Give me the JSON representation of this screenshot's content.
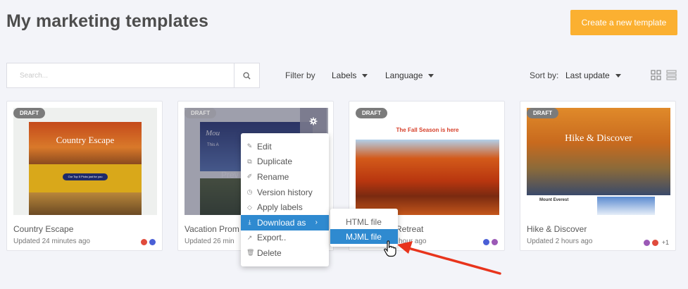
{
  "header": {
    "title": "My marketing templates",
    "create_button": "Create a new template"
  },
  "search": {
    "placeholder": "Search..."
  },
  "filters": {
    "filter_by": "Filter by",
    "labels": "Labels",
    "language": "Language",
    "sort_by": "Sort by:",
    "sort_value": "Last update"
  },
  "cards": [
    {
      "title": "Country Escape",
      "updated": "Updated 24 minutes ago",
      "badge": "DRAFT",
      "thumb_title": "Country Escape",
      "thumb_button": "Our Top 5 Picks just for you",
      "dots": [
        "#e04b3c",
        "#4a5fd6"
      ],
      "extra": ""
    },
    {
      "title": "Vacation Prom",
      "updated": "Updated 26 min",
      "badge": "DRAFT",
      "thumb_title": "Mou",
      "thumb_sub": "This A",
      "thumb_preview": "Previ",
      "dots": [],
      "extra": ""
    },
    {
      "title": "Retreat",
      "updated": "hour ago",
      "badge": "DRAFT",
      "thumb_title": "The Fall Season is here",
      "dots": [
        "#4a5fd6",
        "#9b59b6"
      ],
      "extra": ""
    },
    {
      "title": "Hike & Discover",
      "updated": "Updated 2 hours ago",
      "badge": "DRAFT",
      "thumb_title": "Hike & Discover",
      "thumb_sub": "Mount Everest",
      "dots": [
        "#9b59b6",
        "#e04b3c"
      ],
      "extra": "+1"
    }
  ],
  "context_menu": {
    "items": [
      {
        "label": "Edit",
        "icon": "pencil-icon"
      },
      {
        "label": "Duplicate",
        "icon": "copy-icon"
      },
      {
        "label": "Rename",
        "icon": "rename-icon"
      },
      {
        "label": "Version history",
        "icon": "history-icon"
      },
      {
        "label": "Apply labels",
        "icon": "tag-icon"
      },
      {
        "label": "Download as",
        "icon": "download-icon",
        "active": true
      },
      {
        "label": "Export..",
        "icon": "export-icon"
      },
      {
        "label": "Delete",
        "icon": "trash-icon"
      }
    ]
  },
  "submenu": {
    "items": [
      {
        "label": "HTML file"
      },
      {
        "label": "MJML file",
        "active": true
      }
    ]
  },
  "colors": {
    "accent": "#fbb031",
    "menu_active": "#2f8ad0",
    "annotation_arrow": "#e8341c"
  }
}
